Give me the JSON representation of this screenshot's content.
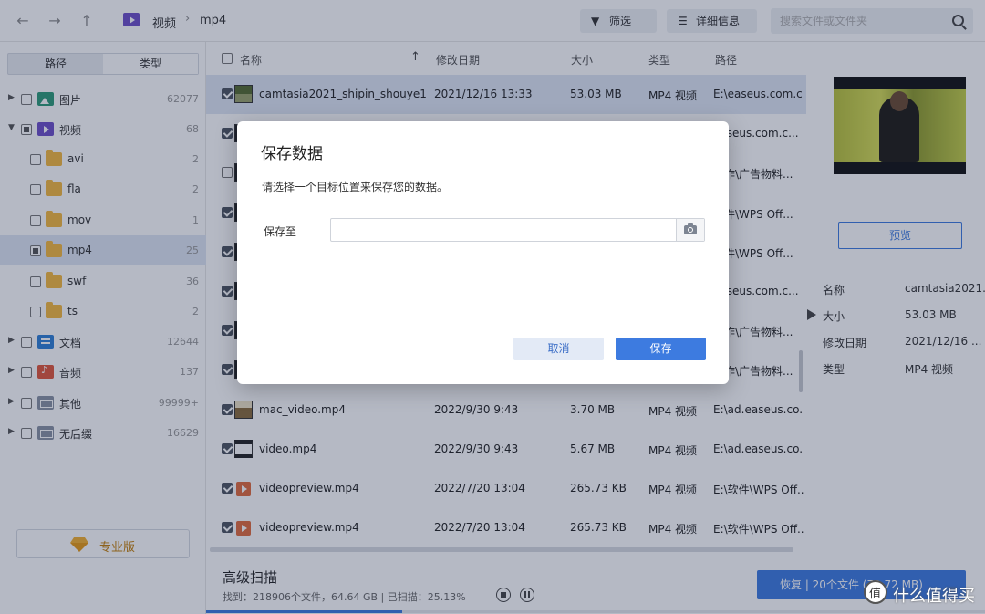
{
  "toolbar": {
    "back": "←",
    "forward": "→",
    "up": "↑",
    "breadcrumb": [
      "视频",
      "mp4"
    ],
    "breadcrumb_sep": "›",
    "filter_label": "筛选",
    "filter_icon": "▼",
    "details_label": "详细信息",
    "details_icon": "☰",
    "search_placeholder": "搜索文件或文件夹"
  },
  "sidebar": {
    "tabs": [
      "路径",
      "类型"
    ],
    "active_tab": "类型",
    "items": [
      {
        "label": "图片",
        "count": "62077",
        "icon": "image-icon",
        "arrow": "▶",
        "check": "none"
      },
      {
        "label": "视频",
        "count": "68",
        "icon": "video-icon",
        "arrow": "▼",
        "check": "partial"
      },
      {
        "label": "avi",
        "count": "2",
        "icon": "folder-icon",
        "check": "none"
      },
      {
        "label": "fla",
        "count": "2",
        "icon": "folder-icon",
        "check": "none"
      },
      {
        "label": "mov",
        "count": "1",
        "icon": "folder-icon",
        "check": "none"
      },
      {
        "label": "mp4",
        "count": "25",
        "icon": "folder-icon",
        "check": "partial",
        "selected": true
      },
      {
        "label": "swf",
        "count": "36",
        "icon": "folder-icon",
        "check": "none"
      },
      {
        "label": "ts",
        "count": "2",
        "icon": "folder-icon",
        "check": "none"
      },
      {
        "label": "文档",
        "count": "12644",
        "icon": "document-icon",
        "arrow": "▶",
        "check": "none"
      },
      {
        "label": "音频",
        "count": "137",
        "icon": "audio-icon",
        "arrow": "▶",
        "check": "none"
      },
      {
        "label": "其他",
        "count": "99999+",
        "icon": "other-icon",
        "arrow": "▶",
        "check": "none"
      },
      {
        "label": "无后缀",
        "count": "16629",
        "icon": "no-extension-icon",
        "arrow": "▶",
        "check": "none"
      }
    ],
    "pro_label": "专业版"
  },
  "file_list": {
    "columns": [
      "名称",
      "修改日期",
      "大小",
      "类型",
      "路径"
    ],
    "sort_icon": "↑",
    "rows": [
      {
        "name": "camtasia2021_shipin_shouye1...",
        "date": "2021/12/16 13:33",
        "size": "53.03 MB",
        "type": "MP4 视频",
        "path": "E:\\easeus.com.c...",
        "thumb": "t-img",
        "selected": true
      },
      {
        "name": "",
        "date": "",
        "size": "",
        "type": "",
        "path": "easeus.com.c...",
        "thumb": "t-dark"
      },
      {
        "name": "",
        "date": "",
        "size": "",
        "type": "",
        "path": "工作\\广告物料...",
        "thumb": "t-dark",
        "unchecked": true
      },
      {
        "name": "",
        "date": "",
        "size": "",
        "type": "",
        "path": "软件\\WPS Off...",
        "thumb": "t-dark"
      },
      {
        "name": "",
        "date": "",
        "size": "",
        "type": "",
        "path": "软件\\WPS Off...",
        "thumb": "t-dark"
      },
      {
        "name": "",
        "date": "",
        "size": "",
        "type": "",
        "path": "easeus.com.c...",
        "thumb": "t-dark"
      },
      {
        "name": "",
        "date": "",
        "size": "",
        "type": "",
        "path": "工作\\广告物料...",
        "thumb": "t-dark"
      },
      {
        "name": "",
        "date": "",
        "size": "",
        "type": "",
        "path": "工作\\广告物料...",
        "thumb": "t-dark"
      },
      {
        "name": "mac_video.mp4",
        "date": "2022/9/30 9:43",
        "size": "3.70 MB",
        "type": "MP4 视频",
        "path": "E:\\ad.easeus.co...",
        "thumb": "t-mac"
      },
      {
        "name": "video.mp4",
        "date": "2022/9/30 9:43",
        "size": "5.67 MB",
        "type": "MP4 视频",
        "path": "E:\\ad.easeus.co...",
        "thumb": "t-vid"
      },
      {
        "name": "videopreview.mp4",
        "date": "2022/7/20 13:04",
        "size": "265.73 KB",
        "type": "MP4 视频",
        "path": "E:\\软件\\WPS Off...",
        "thumb": "t-ppt"
      },
      {
        "name": "videopreview.mp4",
        "date": "2022/7/20 13:04",
        "size": "265.73 KB",
        "type": "MP4 视频",
        "path": "E:\\软件\\WPS Off...",
        "thumb": "t-ppt"
      }
    ]
  },
  "preview": {
    "button_label": "预览",
    "props": [
      {
        "key": "名称",
        "value": "camtasia2021..."
      },
      {
        "key": "大小",
        "value": "53.03 MB"
      },
      {
        "key": "修改日期",
        "value": "2021/12/16 ..."
      },
      {
        "key": "类型",
        "value": "MP4 视频"
      }
    ]
  },
  "bottom": {
    "scan_title": "高级扫描",
    "scan_status": "找到：218906个文件，64.64 GB | 已扫描：25.13%",
    "scan_progress": 0.2513,
    "recover_label": "恢复 | 20个文件 (70.72 MB)"
  },
  "dialog": {
    "title": "保存数据",
    "message": "请选择一个目标位置来保存您的数据。",
    "field_label": "保存至",
    "field_value": "",
    "cancel_label": "取消",
    "save_label": "保存"
  },
  "watermark": {
    "text": "什么值得买"
  },
  "colors": {
    "accent": "#3d7be0",
    "selected_row": "#dfe6f3",
    "overlay": "#182646"
  }
}
